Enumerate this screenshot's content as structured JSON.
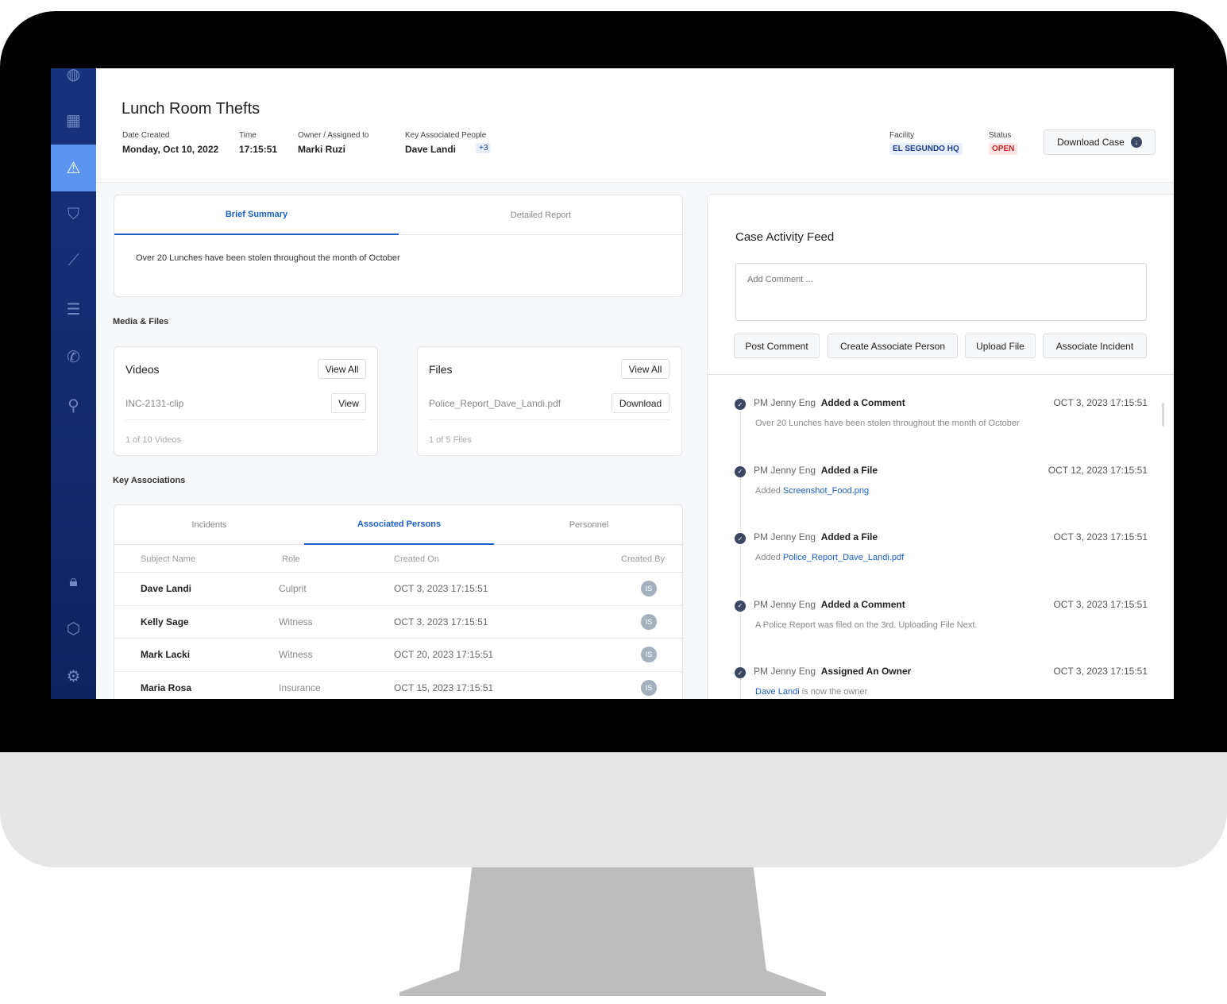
{
  "header": {
    "title": "Lunch Room Thefts",
    "date_label": "Date Created",
    "date": "Monday, Oct 10, 2022",
    "time_label": "Time",
    "time": "17:15:51",
    "owner_label": "Owner / Assigned to",
    "owner": "Marki Ruzi",
    "people_label": "Key Associated People",
    "people": "Dave Landi",
    "people_more": "+3",
    "facility_label": "Facility",
    "facility": "EL SEGUNDO HQ",
    "status_label": "Status",
    "status": "OPEN",
    "download": "Download Case"
  },
  "colors": {
    "sidebar": "#15307a",
    "active": "#5b95f0",
    "accent": "#1c5fc7",
    "status": "#c0262d"
  },
  "summary": {
    "tabs": [
      "Brief Summary",
      "Detailed Report"
    ],
    "text": "Over 20 Lunches have been stolen throughout the month of October"
  },
  "media": {
    "title": "Media & Files",
    "videos": {
      "title": "Videos",
      "view_all": "View All",
      "item": "INC-2131-clip",
      "action": "View",
      "count": "1 of 10 Videos"
    },
    "files": {
      "title": "Files",
      "view_all": "View All",
      "item": "Police_Report_Dave_Landi.pdf",
      "action": "Download",
      "count": "1 of 5 Files"
    }
  },
  "assoc": {
    "title": "Key Associations",
    "tabs": [
      "Incidents",
      "Associated Persons",
      "Personnel"
    ],
    "columns": [
      "Subject Name",
      "Role",
      "Created On",
      "Created By"
    ],
    "rows": [
      {
        "name": "Dave Landi",
        "role": "Culprit",
        "date": "OCT 3, 2023 17:15:51",
        "by": "IS"
      },
      {
        "name": "Kelly Sage",
        "role": "Witness",
        "date": "OCT 3, 2023 17:15:51",
        "by": "IS"
      },
      {
        "name": "Mark Lacki",
        "role": "Witness",
        "date": "OCT 20, 2023 17:15:51",
        "by": "IS"
      },
      {
        "name": "Maria Rosa",
        "role": "Insurance",
        "date": "OCT 15, 2023 17:15:51",
        "by": "IS"
      }
    ]
  },
  "feed": {
    "title": "Case Activity Feed",
    "placeholder": "Add Comment ...",
    "buttons": [
      "Post Comment",
      "Create Associate Person",
      "Upload File",
      "Associate Incident"
    ],
    "items": [
      {
        "user": "PM Jenny Eng",
        "action": "Added a Comment",
        "date": "OCT 3, 2023 17:15:51",
        "pre": "",
        "link": "",
        "post": "Over 20 Lunches have been stolen throughout the month of October"
      },
      {
        "user": "PM Jenny Eng",
        "action": "Added a File",
        "date": "OCT 12, 2023 17:15:51",
        "pre": "Added ",
        "link": "Screenshot_Food.png",
        "post": ""
      },
      {
        "user": "PM Jenny Eng",
        "action": "Added a File",
        "date": "OCT 3, 2023 17:15:51",
        "pre": "Added ",
        "link": "Police_Report_Dave_Landi.pdf",
        "post": ""
      },
      {
        "user": "PM Jenny Eng",
        "action": "Added a Comment",
        "date": "OCT 3, 2023 17:15:51",
        "pre": "",
        "link": "",
        "post": "A Police Report was filed on the 3rd. Uploading File Next."
      },
      {
        "user": "PM Jenny Eng",
        "action": "Assigned An Owner",
        "date": "OCT 3, 2023 17:15:51",
        "pre": "",
        "link": "Dave Landi",
        "post": " is now the owner"
      }
    ]
  }
}
